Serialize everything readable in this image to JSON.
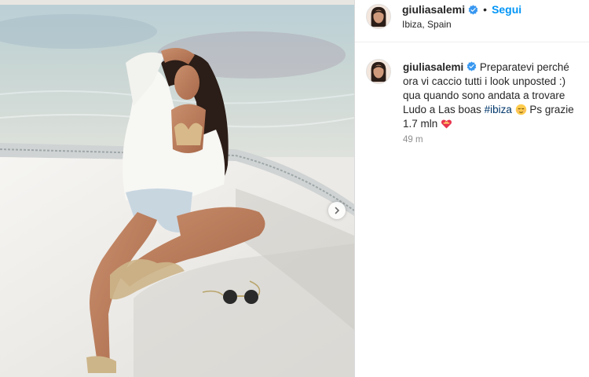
{
  "post": {
    "username": "giuliasalemi",
    "follow_label": "Segui",
    "separator": "•",
    "location": "Ibiza, Spain"
  },
  "caption": {
    "username": "giuliasalemi",
    "text_before_hashtag": "Preparatevi perché ora vi caccio tutti i look unposted :) qua quando sono andata a trovare Ludo a Las boas",
    "hashtag": "#ibiza",
    "text_after_hashtag": "Ps grazie 1.7 mln",
    "emojis": [
      "relieved-face",
      "heart-with-ribbon"
    ],
    "time": "49 m"
  },
  "colors": {
    "accent": "#0095f6",
    "hashtag": "#00376b",
    "verified": "#3897f0",
    "muted": "#8e8e8e"
  },
  "icons": [
    "verified-badge-icon",
    "chevron-right-icon"
  ]
}
